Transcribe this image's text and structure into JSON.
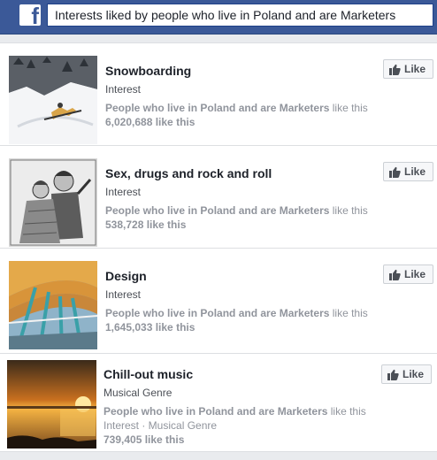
{
  "header": {
    "logo_text": "f",
    "search_value": "Interests liked by people who live in Poland and are Marketers"
  },
  "results": [
    {
      "title": "Snowboarding",
      "category": "Interest",
      "context_prefix": "People who live in Poland and are Marketers",
      "context_suffix": " like this",
      "extra": "",
      "count": "6,020,688 like this",
      "like_label": "Like",
      "thumb_icon": "snowboarder-photo"
    },
    {
      "title": "Sex, drugs and rock and roll",
      "category": "Interest",
      "context_prefix": "People who live in Poland and are Marketers",
      "context_suffix": " like this",
      "extra": "",
      "count": "538,728 like this",
      "like_label": "Like",
      "thumb_icon": "vintage-couple-engraving"
    },
    {
      "title": "Design",
      "category": "Interest",
      "context_prefix": "People who live in Poland and are Marketers",
      "context_suffix": " like this",
      "extra": "",
      "count": "1,645,033 like this",
      "like_label": "Like",
      "thumb_icon": "airport-architecture-photo"
    },
    {
      "title": "Chill-out music",
      "category": "Musical Genre",
      "context_prefix": "People who live in Poland and are Marketers",
      "context_suffix": " like this",
      "extra": "Interest · Musical Genre",
      "count": "739,405 like this",
      "like_label": "Like",
      "thumb_icon": "sunset-sea-photo"
    }
  ],
  "colors": {
    "brand": "#3b5998",
    "text": "#1d2129",
    "muted": "#90949c"
  }
}
